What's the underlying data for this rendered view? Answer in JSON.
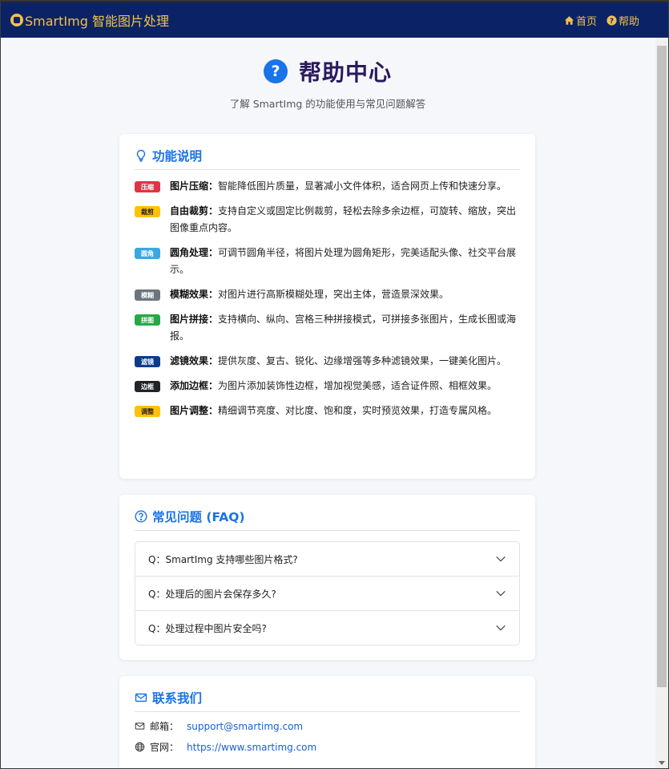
{
  "app": {
    "brand": "SmartImg 智能图片处理"
  },
  "nav": {
    "home": "首页",
    "help": "帮助"
  },
  "header": {
    "title": "帮助中心",
    "subtitle": "了解 SmartImg 的功能使用与常见问题解答"
  },
  "features": {
    "title": "功能说明",
    "items": [
      {
        "badge": "压缩",
        "badge_color": "#dc3545",
        "name": "图片压缩：",
        "desc": "智能降低图片质量，显著减小文件体积，适合网页上传和快速分享。"
      },
      {
        "badge": "裁剪",
        "badge_color": "#ffc107",
        "name": "自由裁剪：",
        "desc": "支持自定义或固定比例裁剪，轻松去除多余边框，可旋转、缩放，突出图像重点内容。"
      },
      {
        "badge": "圆角",
        "badge_color": "#3aa7e0",
        "name": "圆角处理：",
        "desc": "可调节圆角半径，将图片处理为圆角矩形，完美适配头像、社交平台展示。"
      },
      {
        "badge": "模糊",
        "badge_color": "#6c757d",
        "name": "模糊效果：",
        "desc": "对图片进行高斯模糊处理，突出主体，营造景深效果。"
      },
      {
        "badge": "拼图",
        "badge_color": "#28a745",
        "name": "图片拼接：",
        "desc": "支持横向、纵向、宫格三种拼接模式，可拼接多张图片，生成长图或海报。"
      },
      {
        "badge": "滤镜",
        "badge_color": "#0d3b8c",
        "name": "滤镜效果：",
        "desc": "提供灰度、复古、锐化、边缘增强等多种滤镜效果，一键美化图片。"
      },
      {
        "badge": "边框",
        "badge_color": "#212529",
        "name": "添加边框：",
        "desc": "为图片添加装饰性边框，增加视觉美感，适合证件照、相框效果。"
      },
      {
        "badge": "调整",
        "badge_color": "#ffc107",
        "name": "图片调整：",
        "desc": "精细调节亮度、对比度、饱和度，实时预览效果，打造专属风格。"
      }
    ]
  },
  "faq": {
    "title": "常见问题 (FAQ)",
    "items": [
      {
        "q": "Q：SmartImg 支持哪些图片格式?"
      },
      {
        "q": "Q：处理后的图片会保存多久?"
      },
      {
        "q": "Q：处理过程中图片安全吗?"
      }
    ]
  },
  "contact": {
    "title": "联系我们",
    "email_label": "邮箱：",
    "email": "support@smartimg.com",
    "site_label": "官网：",
    "site": "https://www.smartimg.com"
  }
}
